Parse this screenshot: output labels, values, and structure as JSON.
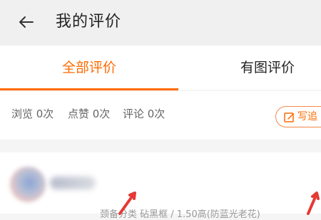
{
  "header": {
    "back_icon": "back-arrow-icon",
    "title": "我的评价"
  },
  "tabs": [
    {
      "label": "全部评价",
      "active": true
    },
    {
      "label": "有图评价",
      "active": false
    }
  ],
  "stats": {
    "browse": "浏览 0次",
    "like": "点赞 0次",
    "comment": "评论 0次"
  },
  "write_button": {
    "icon": "edit-icon",
    "label": "写追"
  },
  "review": {
    "product_text": "颈备分类 砧黑框 / 1.50高(防蓝光老花)"
  },
  "colors": {
    "accent": "#ff6a00",
    "header_bg": "#f0f0f0",
    "page_bg": "#f5f5f5",
    "annotation": "#e53935"
  }
}
